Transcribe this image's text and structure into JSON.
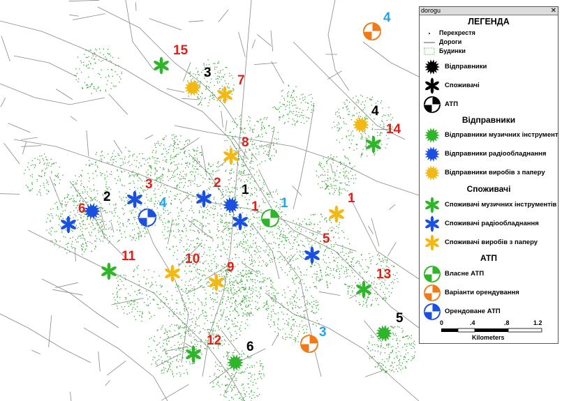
{
  "window_title": "dorogu",
  "legend": {
    "title": "ЛЕГЕНДА",
    "base": [
      {
        "label": "Перехрестя",
        "icon": "dot-icon"
      },
      {
        "label": "Дороги",
        "icon": "line-icon"
      },
      {
        "label": "Будинки",
        "icon": "dotted-box-icon"
      }
    ],
    "generic": [
      {
        "label": "Відправники",
        "icon": "black-starburst-icon"
      },
      {
        "label": "Споживачі",
        "icon": "black-flower-icon"
      },
      {
        "label": "АТП",
        "icon": "black-quartered-circle-icon"
      }
    ],
    "senders_title": "Відправники",
    "senders": [
      {
        "label": "Відправники музичних інструмент",
        "color": "#2eb52a"
      },
      {
        "label": "Відправники радіообладнання",
        "color": "#1a4fe0"
      },
      {
        "label": "Відправники виробів з паперу",
        "color": "#f2b814"
      }
    ],
    "consumers_title": "Споживачі",
    "consumers": [
      {
        "label": "Споживачі музичних інструментів",
        "color": "#2eb52a"
      },
      {
        "label": "Споживачі радіообладнання",
        "color": "#1a4fe0"
      },
      {
        "label": "Споживачі виробів з паперу",
        "color": "#f2b814"
      }
    ],
    "atp_title": "АТП",
    "atp": [
      {
        "label": "Власне АТП",
        "color": "#2eb52a"
      },
      {
        "label": "Варіанти орендування",
        "color": "#f07a18"
      },
      {
        "label": "Орендоване АТП",
        "color": "#1a6fe0"
      }
    ],
    "scale": {
      "ticks": [
        "0",
        ".4",
        ".8",
        "1.2"
      ],
      "unit": "Kilometers"
    }
  },
  "map_labels": [
    "15",
    "3",
    "7",
    "4",
    "4",
    "14",
    "8",
    "2",
    "3",
    "4",
    "2",
    "1",
    "1",
    "1",
    "6",
    "5",
    "11",
    "10",
    "9",
    "13",
    "12",
    "6",
    "3",
    "5"
  ],
  "colors": {
    "red": "#e0201c",
    "black": "#000000",
    "cyan": "#1fa6e8",
    "green": "#2eb52a",
    "blue": "#1a4fe0",
    "yellow": "#f2b814",
    "orange": "#f07a18"
  }
}
